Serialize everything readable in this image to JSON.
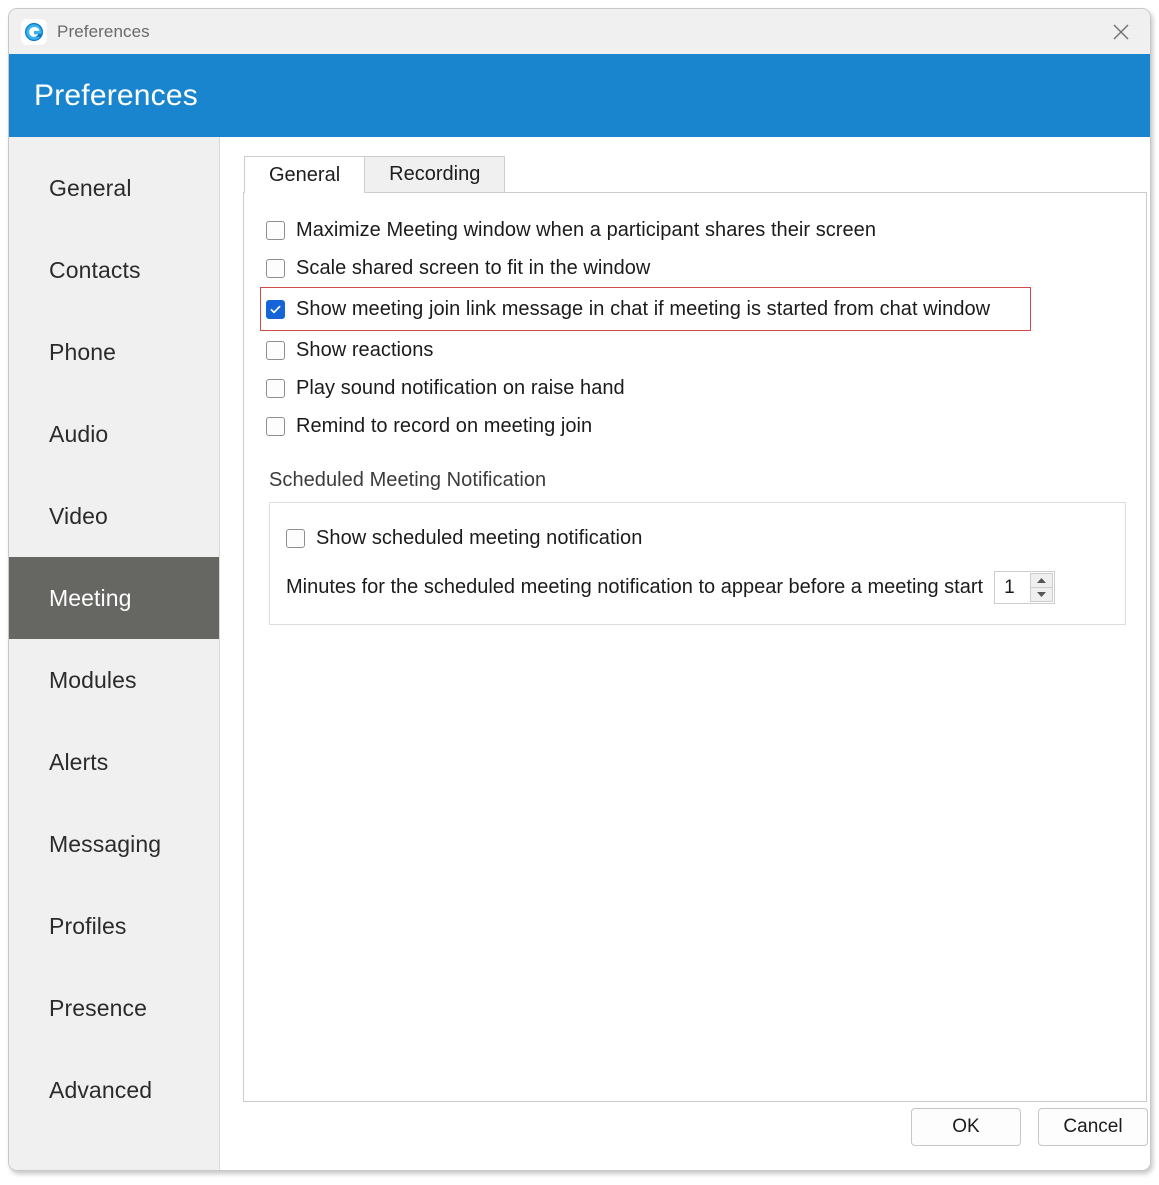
{
  "window": {
    "titlebar_text": "Preferences",
    "app_icon": "goto-logo-icon",
    "close_icon": "close-icon",
    "header_title": "Preferences",
    "header_color": "#1985ce"
  },
  "sidebar": {
    "selected": "Meeting",
    "selected_bg": "#666663",
    "items": [
      {
        "label": "General"
      },
      {
        "label": "Contacts"
      },
      {
        "label": "Phone"
      },
      {
        "label": "Audio"
      },
      {
        "label": "Video"
      },
      {
        "label": "Meeting"
      },
      {
        "label": "Modules"
      },
      {
        "label": "Alerts"
      },
      {
        "label": "Messaging"
      },
      {
        "label": "Profiles"
      },
      {
        "label": "Presence"
      },
      {
        "label": "Advanced"
      }
    ]
  },
  "main": {
    "tabs": [
      {
        "label": "General",
        "active": true
      },
      {
        "label": "Recording",
        "active": false
      }
    ],
    "checkboxes": [
      {
        "label": "Maximize Meeting window when a participant shares their screen",
        "checked": false,
        "highlighted": false
      },
      {
        "label": "Scale shared screen to fit in the window",
        "checked": false,
        "highlighted": false
      },
      {
        "label": "Show meeting join link message in chat if meeting is started from chat window",
        "checked": true,
        "highlighted": true
      },
      {
        "label": "Show reactions",
        "checked": false,
        "highlighted": false
      },
      {
        "label": "Play sound notification on raise hand",
        "checked": false,
        "highlighted": false
      },
      {
        "label": "Remind to record on meeting join",
        "checked": false,
        "highlighted": false
      }
    ],
    "highlight_color": "#d14b4b",
    "checked_color": "#1565d8",
    "group": {
      "title": "Scheduled Meeting Notification",
      "checkbox": {
        "label": "Show scheduled meeting notification",
        "checked": false
      },
      "minutes_label": "Minutes for the scheduled meeting notification to appear before a meeting start",
      "minutes_value": "1",
      "spinner_up_icon": "chevron-up-icon",
      "spinner_down_icon": "chevron-down-icon"
    }
  },
  "footer": {
    "ok_label": "OK",
    "cancel_label": "Cancel"
  }
}
